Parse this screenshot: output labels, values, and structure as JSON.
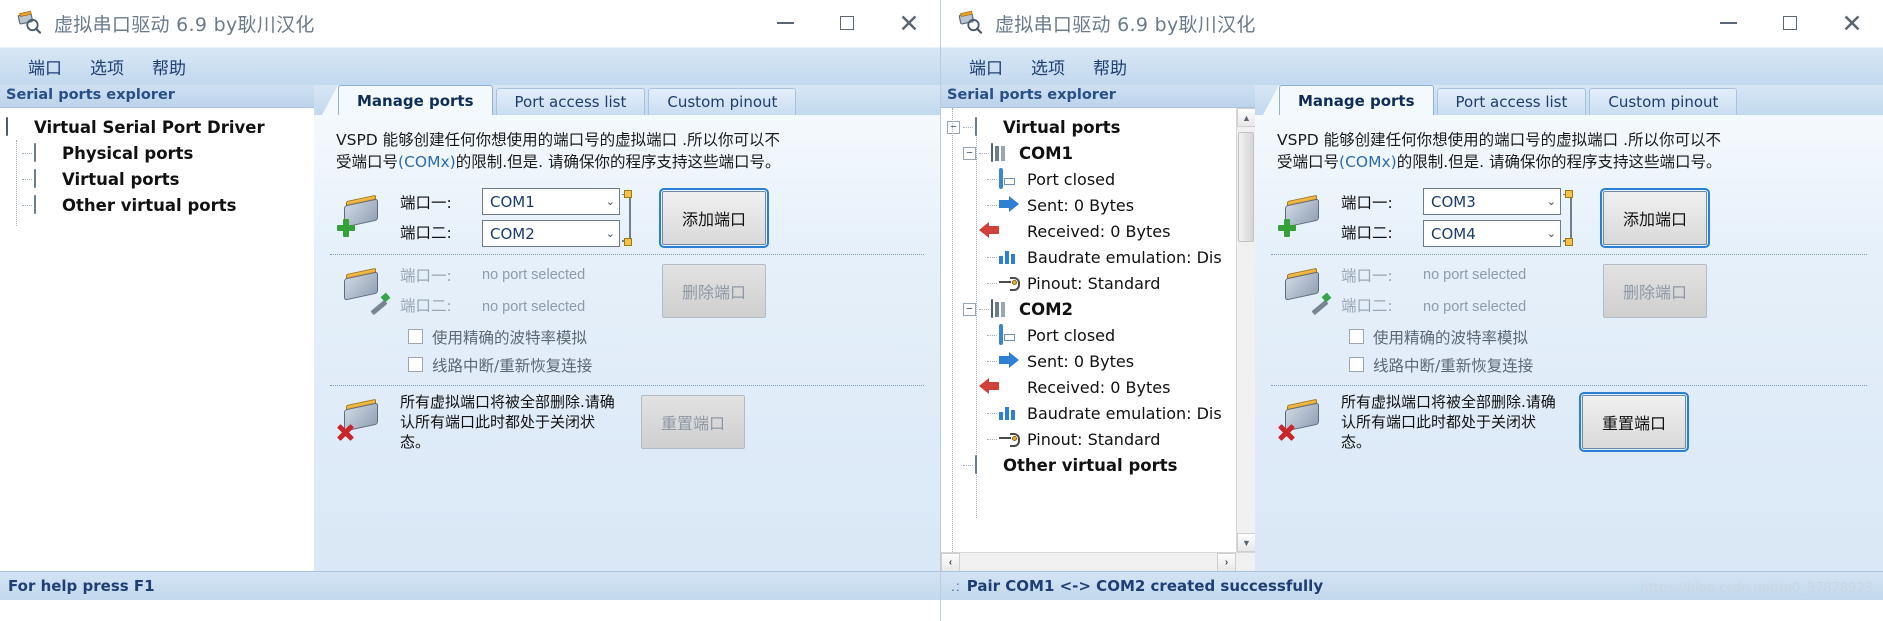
{
  "window_title": "虚拟串口驱动 6.9 by耿川汉化",
  "window_controls": {
    "minimize": "—",
    "maximize": "□",
    "close": "✕"
  },
  "menu": {
    "items": [
      "端口",
      "选项",
      "帮助"
    ]
  },
  "explorer": {
    "header": "Serial ports explorer",
    "left_tree": [
      {
        "label": "Virtual Serial Port Driver",
        "icon": "driver-icon",
        "level": 0,
        "bold": true
      },
      {
        "label": "Physical ports",
        "icon": "monitor-icon",
        "level": 1,
        "bold": true
      },
      {
        "label": "Virtual ports",
        "icon": "monitor-icon",
        "level": 1,
        "bold": true
      },
      {
        "label": "Other virtual ports",
        "icon": "monitor-icon",
        "level": 1,
        "bold": true
      }
    ],
    "right_tree": [
      {
        "label": "Virtual ports",
        "icon": "monitor-icon",
        "level": 0,
        "bold": true,
        "expander": "-"
      },
      {
        "label": "COM1",
        "icon": "port-icon",
        "level": 1,
        "bold": false,
        "expander": "-"
      },
      {
        "label": "Port closed",
        "icon": "window-icon",
        "level": 2,
        "bold": false
      },
      {
        "label": "Sent: 0 Bytes",
        "icon": "arrow-right-icon",
        "level": 2,
        "bold": false
      },
      {
        "label": "Received: 0 Bytes",
        "icon": "arrow-left-icon",
        "level": 2,
        "bold": false
      },
      {
        "label": "Baudrate emulation: Dis",
        "icon": "bars-icon",
        "level": 2,
        "bold": false
      },
      {
        "label": "Pinout: Standard",
        "icon": "pinout-icon",
        "level": 2,
        "bold": false
      },
      {
        "label": "COM2",
        "icon": "port-icon",
        "level": 1,
        "bold": false,
        "expander": "-"
      },
      {
        "label": "Port closed",
        "icon": "window-icon",
        "level": 2,
        "bold": false
      },
      {
        "label": "Sent: 0 Bytes",
        "icon": "arrow-right-icon",
        "level": 2,
        "bold": false
      },
      {
        "label": "Received: 0 Bytes",
        "icon": "arrow-left-icon",
        "level": 2,
        "bold": false
      },
      {
        "label": "Baudrate emulation: Dis",
        "icon": "bars-icon",
        "level": 2,
        "bold": false
      },
      {
        "label": "Pinout: Standard",
        "icon": "pinout-icon",
        "level": 2,
        "bold": false
      },
      {
        "label": "Other virtual ports",
        "icon": "monitor-icon",
        "level": 0,
        "bold": true
      }
    ]
  },
  "tabs": [
    {
      "label": "Manage ports",
      "active": true
    },
    {
      "label": "Port access list",
      "active": false
    },
    {
      "label": "Custom pinout",
      "active": false
    }
  ],
  "panel": {
    "description_line1": "VSPD 能够创建任何你想使用的端口号的虚拟端口 .所以你可以不",
    "description_line2_a": "受端口号",
    "description_line2_accent": "(COMx)",
    "description_line2_b": "的限制.但是. 请确保你的程序支持这些端口号。",
    "add_section": {
      "label_port1": "端口一:",
      "label_port2": "端口二:",
      "button": "添加端口"
    },
    "delete_section": {
      "label_port1": "端口一:",
      "label_port2": "端口二:",
      "value_port1": "no port selected",
      "value_port2": "no port selected",
      "button": "删除端口"
    },
    "checkboxes": [
      {
        "label": "使用精确的波特率模拟",
        "checked": false
      },
      {
        "label": "线路中断/重新恢复连接",
        "checked": false
      }
    ],
    "reset_section": {
      "text": "所有虚拟端口将被全部删除.请确认所有端口此时都处于关闭状态。",
      "button": "重置端口"
    }
  },
  "left_window": {
    "combo_port1": "COM1",
    "combo_port2": "COM2",
    "status": "For help press F1"
  },
  "right_window": {
    "combo_port1": "COM3",
    "combo_port2": "COM4",
    "status": "Pair COM1 <-> COM2 created successfully"
  },
  "watermark": "https://blog.csdn.net/m0_37878923",
  "colors": {
    "accent_blue": "#2b6cb0",
    "titlebar_text": "#6b7b8c",
    "menu_text": "#1f3f73",
    "panel_bg": "#e6f0fa",
    "button_focus": "#2a7fd4"
  }
}
